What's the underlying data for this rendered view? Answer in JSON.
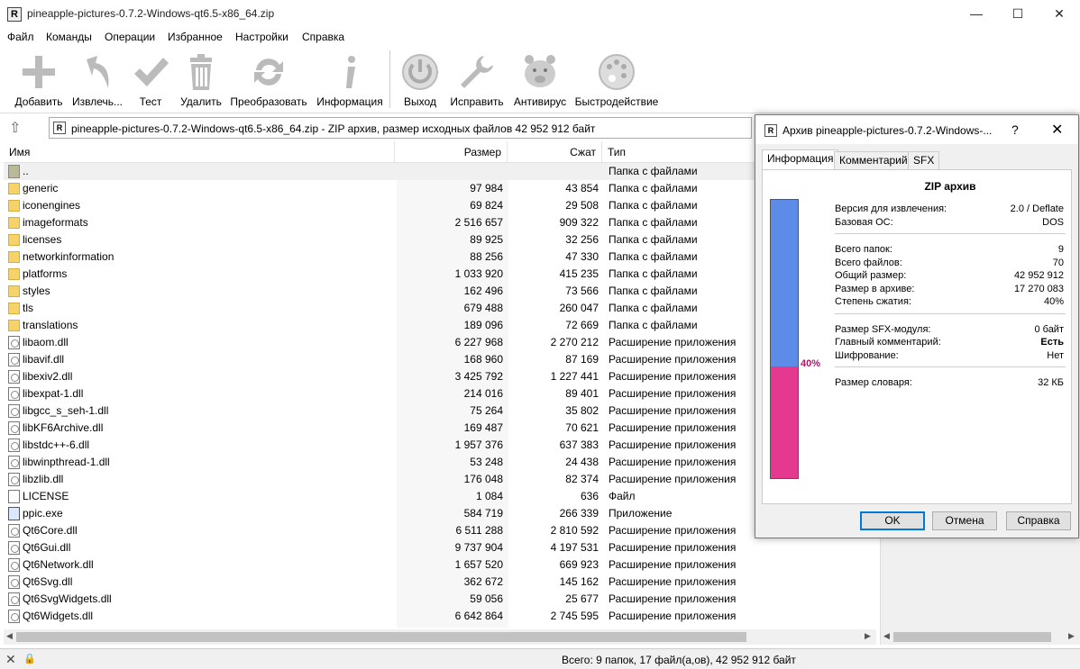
{
  "window": {
    "title": "pineapple-pictures-0.7.2-Windows-qt6.5-x86_64.zip",
    "app_icon_letter": "R"
  },
  "menu": [
    "Файл",
    "Команды",
    "Операции",
    "Избранное",
    "Настройки",
    "Справка"
  ],
  "toolbar": [
    {
      "label": "Добавить",
      "icon": "add-icon"
    },
    {
      "label": "Извлечь...",
      "icon": "extract-icon"
    },
    {
      "label": "Тест",
      "icon": "test-check-icon"
    },
    {
      "label": "Удалить",
      "icon": "trash-icon"
    },
    {
      "label": "Преобразовать",
      "icon": "convert-icon"
    },
    {
      "label": "Информация",
      "icon": "info-icon"
    },
    {
      "label": "Выход",
      "icon": "power-icon"
    },
    {
      "label": "Исправить",
      "icon": "wrench-icon"
    },
    {
      "label": "Антивирус",
      "icon": "antivirus-icon"
    },
    {
      "label": "Быстродействие",
      "icon": "palette-icon"
    }
  ],
  "address": "pineapple-pictures-0.7.2-Windows-qt6.5-x86_64.zip - ZIP архив, размер исходных файлов 42 952 912 байт",
  "columns": {
    "name": "Имя",
    "size": "Размер",
    "packed": "Сжат",
    "type": "Тип"
  },
  "files": [
    {
      "name": "..",
      "size": "",
      "packed": "",
      "type": "Папка с файлами",
      "icon": "folder-up"
    },
    {
      "name": "generic",
      "size": "97 984",
      "packed": "43 854",
      "type": "Папка с файлами",
      "icon": "folder"
    },
    {
      "name": "iconengines",
      "size": "69 824",
      "packed": "29 508",
      "type": "Папка с файлами",
      "icon": "folder"
    },
    {
      "name": "imageformats",
      "size": "2 516 657",
      "packed": "909 322",
      "type": "Папка с файлами",
      "icon": "folder"
    },
    {
      "name": "licenses",
      "size": "89 925",
      "packed": "32 256",
      "type": "Папка с файлами",
      "icon": "folder"
    },
    {
      "name": "networkinformation",
      "size": "88 256",
      "packed": "47 330",
      "type": "Папка с файлами",
      "icon": "folder"
    },
    {
      "name": "platforms",
      "size": "1 033 920",
      "packed": "415 235",
      "type": "Папка с файлами",
      "icon": "folder"
    },
    {
      "name": "styles",
      "size": "162 496",
      "packed": "73 566",
      "type": "Папка с файлами",
      "icon": "folder"
    },
    {
      "name": "tls",
      "size": "679 488",
      "packed": "260 047",
      "type": "Папка с файлами",
      "icon": "folder"
    },
    {
      "name": "translations",
      "size": "189 096",
      "packed": "72 669",
      "type": "Папка с файлами",
      "icon": "folder"
    },
    {
      "name": "libaom.dll",
      "size": "6 227 968",
      "packed": "2 270 212",
      "type": "Расширение приложения",
      "icon": "dll"
    },
    {
      "name": "libavif.dll",
      "size": "168 960",
      "packed": "87 169",
      "type": "Расширение приложения",
      "icon": "dll"
    },
    {
      "name": "libexiv2.dll",
      "size": "3 425 792",
      "packed": "1 227 441",
      "type": "Расширение приложения",
      "icon": "dll"
    },
    {
      "name": "libexpat-1.dll",
      "size": "214 016",
      "packed": "89 401",
      "type": "Расширение приложения",
      "icon": "dll"
    },
    {
      "name": "libgcc_s_seh-1.dll",
      "size": "75 264",
      "packed": "35 802",
      "type": "Расширение приложения",
      "icon": "dll"
    },
    {
      "name": "libKF6Archive.dll",
      "size": "169 487",
      "packed": "70 621",
      "type": "Расширение приложения",
      "icon": "dll"
    },
    {
      "name": "libstdc++-6.dll",
      "size": "1 957 376",
      "packed": "637 383",
      "type": "Расширение приложения",
      "icon": "dll"
    },
    {
      "name": "libwinpthread-1.dll",
      "size": "53 248",
      "packed": "24 438",
      "type": "Расширение приложения",
      "icon": "dll"
    },
    {
      "name": "libzlib.dll",
      "size": "176 048",
      "packed": "82 374",
      "type": "Расширение приложения",
      "icon": "dll"
    },
    {
      "name": "LICENSE",
      "size": "1 084",
      "packed": "636",
      "type": "Файл",
      "icon": "file"
    },
    {
      "name": "ppic.exe",
      "size": "584 719",
      "packed": "266 339",
      "type": "Приложение",
      "icon": "exe"
    },
    {
      "name": "Qt6Core.dll",
      "size": "6 511 288",
      "packed": "2 810 592",
      "type": "Расширение приложения",
      "icon": "dll"
    },
    {
      "name": "Qt6Gui.dll",
      "size": "9 737 904",
      "packed": "4 197 531",
      "type": "Расширение приложения",
      "icon": "dll"
    },
    {
      "name": "Qt6Network.dll",
      "size": "1 657 520",
      "packed": "669 923",
      "type": "Расширение приложения",
      "icon": "dll"
    },
    {
      "name": "Qt6Svg.dll",
      "size": "362 672",
      "packed": "145 162",
      "type": "Расширение приложения",
      "icon": "dll"
    },
    {
      "name": "Qt6SvgWidgets.dll",
      "size": "59 056",
      "packed": "25 677",
      "type": "Расширение приложения",
      "icon": "dll"
    },
    {
      "name": "Qt6Widgets.dll",
      "size": "6 642 864",
      "packed": "2 745 595",
      "type": "Расширение приложения",
      "icon": "dll"
    }
  ],
  "status": "Всего: 9 папок, 17 файл(а,ов), 42 952 912 байт",
  "dialog": {
    "title": "Архив pineapple-pictures-0.7.2-Windows-...",
    "help": "?",
    "close": "✕",
    "tabs": [
      "Информация",
      "Комментарий",
      "SFX"
    ],
    "heading": "ZIP архив",
    "ratio_percent": 40,
    "ratio_label": "40%",
    "groups": [
      [
        {
          "label": "Версия для извлечения:",
          "value": "2.0 / Deflate"
        },
        {
          "label": "Базовая ОС:",
          "value": "DOS"
        }
      ],
      [
        {
          "label": "Всего папок:",
          "value": "9"
        },
        {
          "label": "Всего файлов:",
          "value": "70"
        },
        {
          "label": "Общий размер:",
          "value": "42 952 912"
        },
        {
          "label": "Размер в архиве:",
          "value": "17 270 083"
        },
        {
          "label": "Степень сжатия:",
          "value": "40%"
        }
      ],
      [
        {
          "label": "Размер SFX-модуля:",
          "value": "0 байт"
        },
        {
          "label": "Главный комментарий:",
          "value": "Есть",
          "bold": true
        },
        {
          "label": "Шифрование:",
          "value": "Нет"
        }
      ],
      [
        {
          "label": "Размер словаря:",
          "value": "32 КБ"
        }
      ]
    ],
    "buttons": {
      "ok": "OK",
      "cancel": "Отмена",
      "help": "Справка"
    },
    "colors": {
      "unpacked": "#5d8ce8",
      "packed": "#e4398f"
    }
  }
}
